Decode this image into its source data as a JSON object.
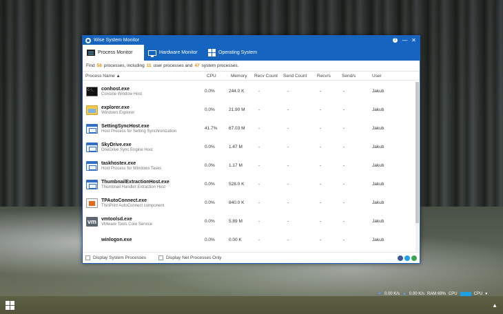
{
  "window": {
    "title": "Wise System Monitor"
  },
  "tabs": [
    {
      "label": "Process Monitor",
      "icon": "process-monitor-icon"
    },
    {
      "label": "Hardware Monitor",
      "icon": "monitor-icon"
    },
    {
      "label": "Operating System",
      "icon": "windows-icon"
    }
  ],
  "summary": {
    "find": "Find",
    "total": "58",
    "processes_including": "processes, including",
    "user_count": "11",
    "user_processes_and": "user processes and",
    "system_count": "47",
    "system_processes": "system processes."
  },
  "columns": {
    "name": "Process Name ▲",
    "cpu": "CPU",
    "memory": "Memory",
    "recv_count": "Recv Count",
    "send_count": "Send Count",
    "recv_s": "Recv/s",
    "send_s": "Send/s",
    "user": "User"
  },
  "processes": [
    {
      "name": "conhost.exe",
      "desc": "Console Window Host",
      "cpu": "0.0%",
      "memory": "244.0 K",
      "recv": "-",
      "send": "-",
      "recvs": "-",
      "sends": "-",
      "user": "Jakub",
      "icon": "console-icon"
    },
    {
      "name": "explorer.exe",
      "desc": "Windows Explorer",
      "cpu": "0.0%",
      "memory": "21.90 M",
      "recv": "-",
      "send": "-",
      "recvs": "-",
      "sends": "-",
      "user": "Jakub",
      "icon": "folder-icon"
    },
    {
      "name": "SettingSyncHost.exe",
      "desc": "Host Process for Setting Synchronization",
      "cpu": "41.7%",
      "memory": "67.03 M",
      "recv": "-",
      "send": "-",
      "recvs": "-",
      "sends": "-",
      "user": "Jakub",
      "icon": "app-window-icon"
    },
    {
      "name": "SkyDrive.exe",
      "desc": "OneDrive Sync Engine Host",
      "cpu": "0.0%",
      "memory": "1.47 M",
      "recv": "-",
      "send": "-",
      "recvs": "-",
      "sends": "-",
      "user": "Jakub",
      "icon": "app-window-icon"
    },
    {
      "name": "taskhostex.exe",
      "desc": "Host Process for Windows Tasks",
      "cpu": "0.0%",
      "memory": "1.17 M",
      "recv": "-",
      "send": "-",
      "recvs": "-",
      "sends": "-",
      "user": "Jakub",
      "icon": "app-window-icon"
    },
    {
      "name": "ThumbnailExtractionHost.exe",
      "desc": "Thumbnail Handler Extraction Host",
      "cpu": "0.0%",
      "memory": "528.0 K",
      "recv": "-",
      "send": "-",
      "recvs": "-",
      "sends": "-",
      "user": "Jakub",
      "icon": "app-window-icon"
    },
    {
      "name": "TPAutoConnect.exe",
      "desc": "ThinPrint AutoConnect component",
      "cpu": "0.0%",
      "memory": "840.0 K",
      "recv": "-",
      "send": "-",
      "recvs": "-",
      "sends": "-",
      "user": "Jakub",
      "icon": "printer-icon"
    },
    {
      "name": "vmtoolsd.exe",
      "desc": "VMware Tools Core Service",
      "cpu": "0.0%",
      "memory": "5.89 M",
      "recv": "-",
      "send": "-",
      "recvs": "-",
      "sends": "-",
      "user": "Jakub",
      "icon": "vmware-icon"
    },
    {
      "name": "winlogon.exe",
      "desc": "",
      "cpu": "0.0%",
      "memory": "0.00 K",
      "recv": "-",
      "send": "-",
      "recvs": "-",
      "sends": "-",
      "user": "Jakub",
      "icon": "blank-icon"
    }
  ],
  "footer": {
    "display_system": "Display System Processes",
    "display_net": "Display Net Processes Only"
  },
  "wise_bar": {
    "down": "0.00 K/s",
    "up": "0.00 K/s",
    "ram": "RAM 69%",
    "cpu": "CPU",
    "cpu2": "CPU"
  },
  "colors": {
    "accent": "#1565c0",
    "count_highlight": "#f08a00"
  }
}
